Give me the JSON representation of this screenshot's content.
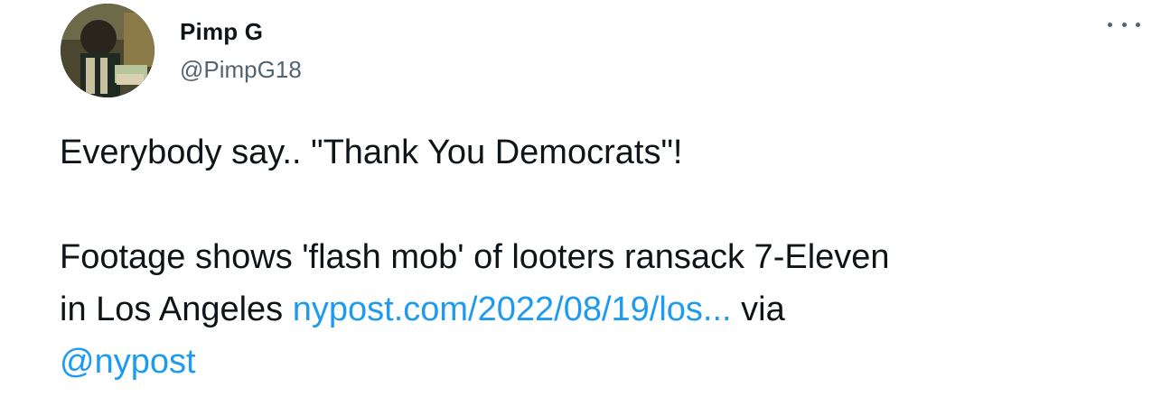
{
  "author": {
    "display_name": "Pimp G",
    "handle": "@PimpG18",
    "avatar_icon": "user-avatar"
  },
  "menu": {
    "more_icon": "more-horizontal-icon"
  },
  "tweet": {
    "line1": "Everybody say.. \"Thank You Democrats\"!",
    "line2": "Footage shows 'flash mob' of looters ransack 7-Eleven",
    "line3_text": "in Los Angeles ",
    "link_url": "nypost.com/2022/08/19/los...",
    "via_text": " via",
    "mention": "@nypost"
  },
  "colors": {
    "text": "#0f1419",
    "secondary": "#536471",
    "link": "#1d9bf0"
  }
}
